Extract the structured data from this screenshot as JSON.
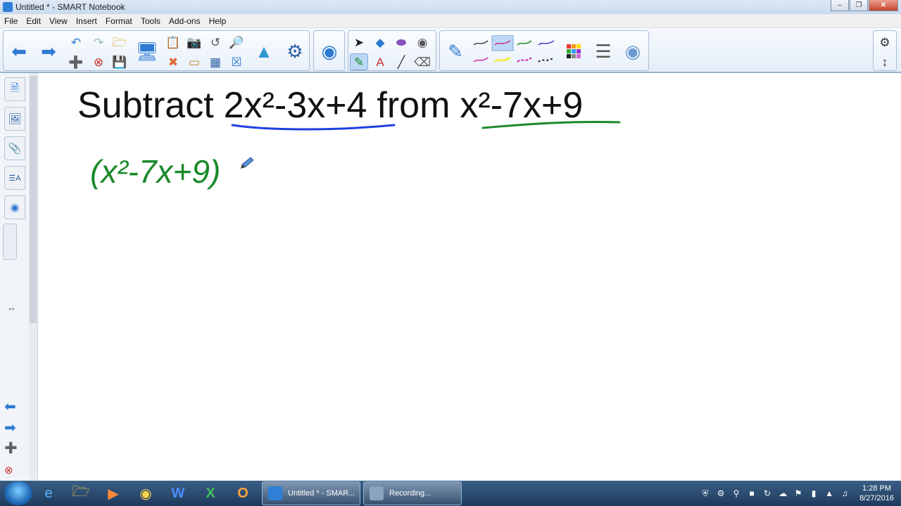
{
  "window": {
    "title": "Untitled * - SMART Notebook"
  },
  "menu": [
    "File",
    "Edit",
    "View",
    "Insert",
    "Format",
    "Tools",
    "Add-ons",
    "Help"
  ],
  "canvas": {
    "heading_parts": [
      "Subtract",
      "2x²-3x+4",
      "from",
      "x²-7x+9"
    ],
    "handwritten": "(x²-7x+9)",
    "colors": {
      "blue_underline": "#1f3fe0",
      "green_ink": "#1a8a2a"
    }
  },
  "taskbar": {
    "tasks": [
      {
        "label": "Untitled * - SMAR..."
      },
      {
        "label": "Recording..."
      }
    ],
    "clock": {
      "time": "1:28 PM",
      "date": "8/27/2016"
    }
  }
}
